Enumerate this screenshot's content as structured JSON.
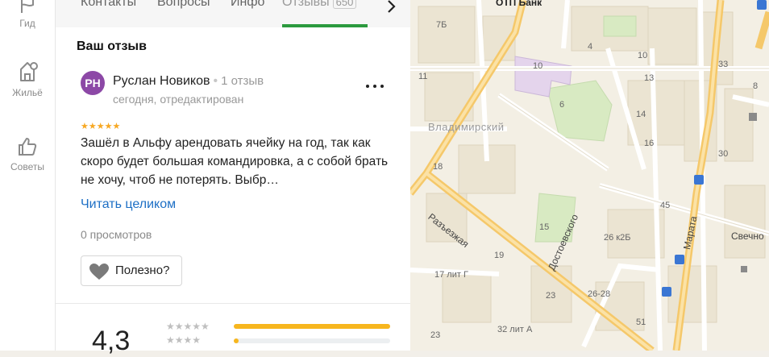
{
  "sidebar": {
    "items": [
      {
        "label": "Гид",
        "icon": "flag-icon"
      },
      {
        "label": "Жильё",
        "icon": "house-icon"
      },
      {
        "label": "Советы",
        "icon": "thumbs-up-icon"
      }
    ]
  },
  "tabs": {
    "items": [
      {
        "label": "Контакты"
      },
      {
        "label": "Вопросы"
      },
      {
        "label": "Инфо"
      },
      {
        "label": "Отзывы",
        "count": "650",
        "active": true
      }
    ]
  },
  "review": {
    "section_title": "Ваш отзыв",
    "avatar_initials": "РН",
    "avatar_color": "#8c48a6",
    "author": "Руслан Новиков",
    "author_reviews": "1 отзыв",
    "date": "сегодня, отредактирован",
    "stars": 5,
    "text": "Зашёл в Альфу арендовать ячейку на год, так как скоро будет большая командировка, а с собой брать не хочу, чтоб не потерять. Выбр…",
    "read_more": "Читать целиком",
    "views": "0 просмотров",
    "useful_label": "Полезно?"
  },
  "rating": {
    "value": "4,3",
    "distribution": [
      {
        "stars": 5,
        "share": 1.0
      },
      {
        "stars": 4,
        "share": 0.03
      }
    ]
  },
  "map": {
    "labels": {
      "bank": "ОТП Банк",
      "district": "Владимирский",
      "street_razezzhaya": "Разъезжая",
      "street_dostoevskogo": "Достоевского",
      "street_marata": "Марата",
      "street_svechnoy": "Свечно"
    },
    "house_numbers": [
      "7Б",
      "10",
      "4",
      "11",
      "6",
      "10",
      "14",
      "18",
      "13",
      "16",
      "33",
      "8",
      "30",
      "45",
      "15",
      "26 к2Б",
      "19",
      "17 лит Г",
      "26-28",
      "23",
      "51",
      "32 лит А",
      "23"
    ]
  }
}
